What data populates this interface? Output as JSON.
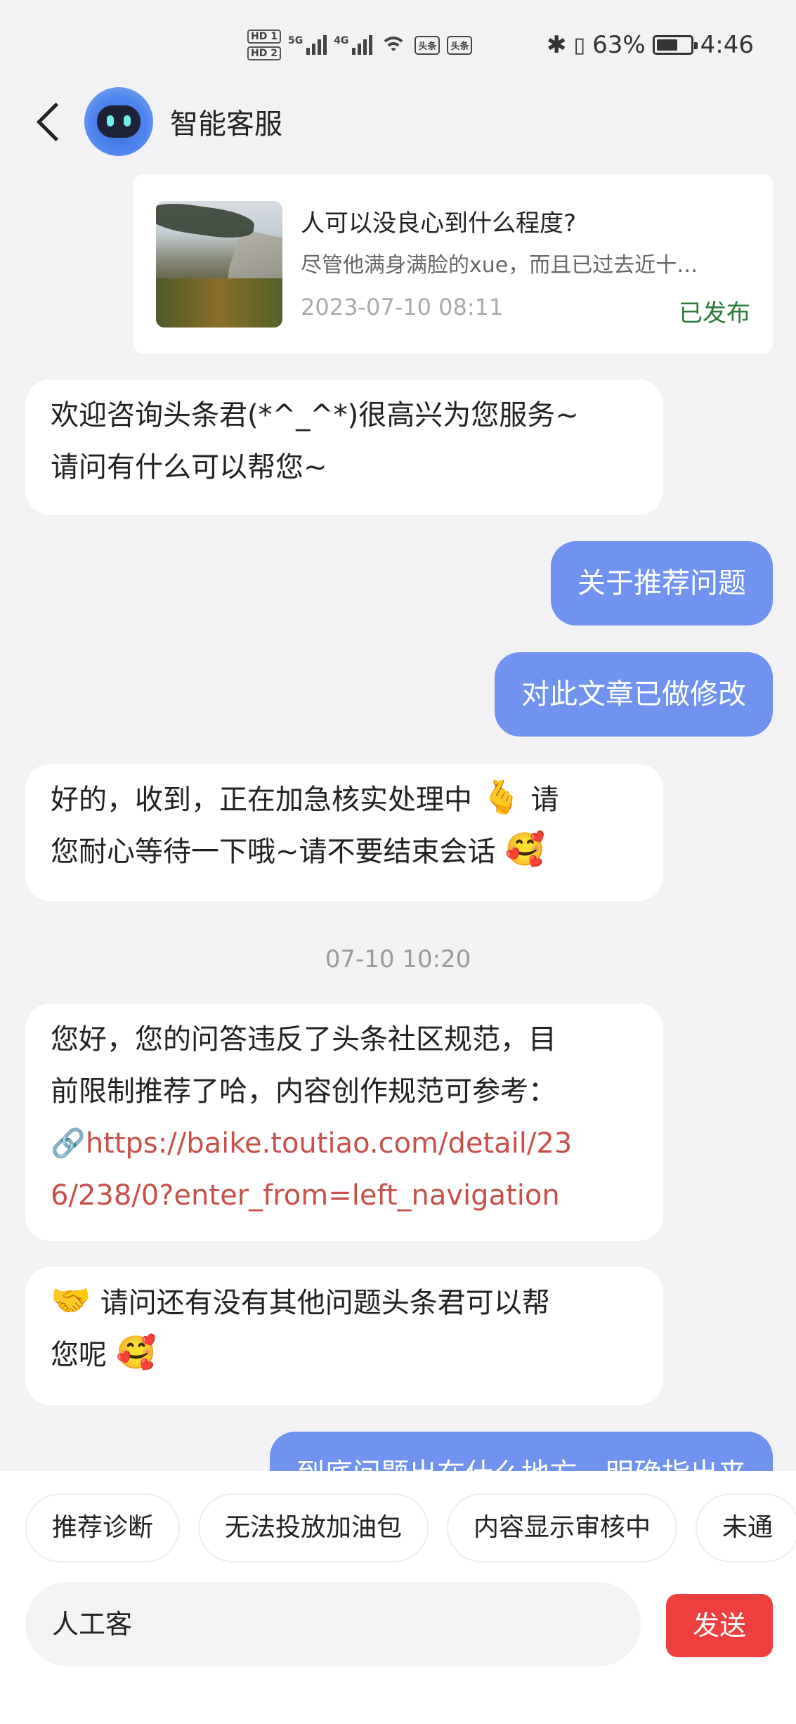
{
  "status_bar": {
    "hd1": "HD 1",
    "hd2": "HD 2",
    "net1": "5G",
    "net2": "4G",
    "app_icon1": "头条",
    "app_icon2": "头条",
    "battery_pct": "63%",
    "battery_level": 0.63,
    "time": "4:46",
    "icons": [
      "signal-icon",
      "wifi-icon",
      "bluetooth-icon",
      "vibrate-icon",
      "battery-icon"
    ]
  },
  "header": {
    "title": "智能客服"
  },
  "article": {
    "title": "人可以没良心到什么程度?",
    "excerpt": "尽管他满身满脸的xue，而且已过去近十…",
    "date": "2023-07-10 08:11",
    "status": "已发布",
    "status_color": "#2c7a3c"
  },
  "messages": {
    "m1": {
      "line1": "欢迎咨询头条君(*^_^*)很高兴为您服务~",
      "line2": "请问有什么可以帮您~"
    },
    "m2": "关于推荐问题",
    "m3": "对此文章已做修改",
    "m4": {
      "line1a": "好的，收到，正在加急核实处理中",
      "line1b": "请",
      "line2": "您耐心等待一下哦~请不要结束会话"
    },
    "time": "07-10 10:20",
    "m5": {
      "line1": "您好，您的问答违反了头条社区规范，目",
      "line2": "前限制推荐了哈，内容创作规范可参考：",
      "link1": "https://baike.toutiao.com/detail/23",
      "link2": "6/238/0?enter_from=left_navigation"
    },
    "m6": {
      "line1": "请问还有没有其他问题头条君可以帮",
      "line2": "您呢"
    },
    "m7_partial": "到底问题出在什么地方，明确指出来"
  },
  "bottom": {
    "chips": [
      "推荐诊断",
      "无法投放加油包",
      "内容显示审核中",
      "未通"
    ],
    "input_value": "人工客",
    "send_label": "发送",
    "send_color": "#ee3f3f"
  },
  "colors": {
    "accent_bubble": "#6f93ee",
    "link": "#c9504a",
    "background": "#f2f2f4"
  }
}
